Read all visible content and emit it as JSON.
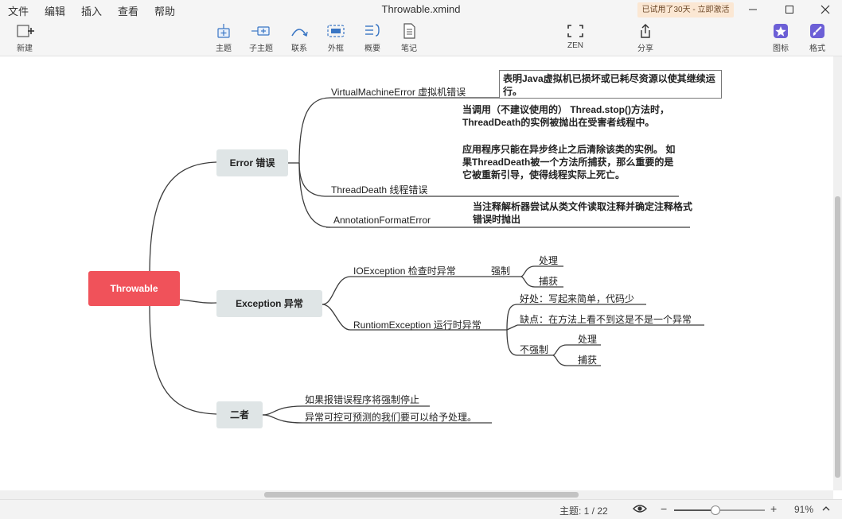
{
  "menu": [
    "文件",
    "编辑",
    "插入",
    "查看",
    "帮助"
  ],
  "title": "Throwable.xmind",
  "trial_badge": "已试用了30天 - 立即激活",
  "toolbar": {
    "new": "新建",
    "topic": "主题",
    "subtopic": "子主题",
    "relation": "联系",
    "boundary": "外框",
    "summary": "概要",
    "note": "笔记",
    "zen": "ZEN",
    "share": "分享",
    "icon": "图标",
    "format": "格式"
  },
  "mindmap": {
    "root": "Throwable",
    "error": {
      "label": "Error 错误",
      "vme": "VirtualMachineError 虚拟机错误",
      "vme_note": "表明Java虚拟机已损坏或已耗尽资源以使其继续运行。",
      "td": "ThreadDeath 线程错误",
      "td_note_1": "当调用（不建议使用的） Thread.stop()方法时， ThreadDeath的实例被抛出在受害者线程中。",
      "td_note_2": "应用程序只能在异步终止之后清除该类的实例。 如果ThreadDeath被一个方法所捕获，那么重要的是它被重新引导，使得线程实际上死亡。",
      "afe": "AnnotationFormatError",
      "afe_note": "当注释解析器尝试从类文件读取注释并确定注释格式错误时抛出"
    },
    "exception": {
      "label": "Exception 异常",
      "io": "IOException 检查时异常",
      "io_force": "强制",
      "io_handle": "处理",
      "io_catch": "捕获",
      "rt": "RuntiomException 运行时异常",
      "rt_pro": "好处：写起来简单，代码少",
      "rt_con": "缺点：在方法上看不到这是不是一个异常",
      "rt_noforce": "不强制",
      "rt_handle": "处理",
      "rt_catch": "捕获"
    },
    "both": {
      "label": "二者",
      "line1": "如果报错误程序将强制停止",
      "line2": "异常可控可预测的我们要可以给予处理。"
    }
  },
  "status": {
    "topic_count": "主题: 1 / 22",
    "zoom": "91%",
    "zoom_level": 0.46,
    "minus": "−",
    "plus": "+"
  }
}
